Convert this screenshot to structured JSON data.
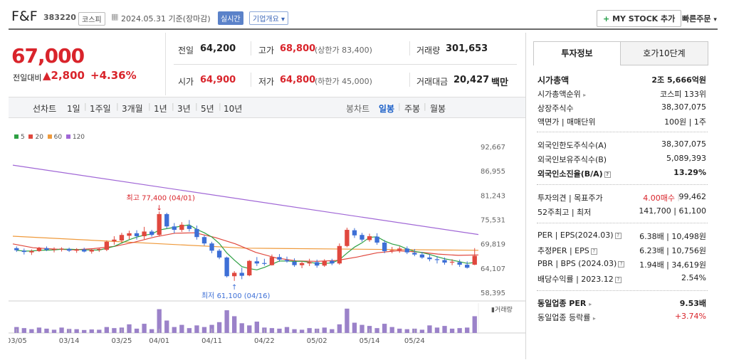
{
  "header": {
    "name": "F&F",
    "code": "383220",
    "market": "코스피",
    "date": "2024.05.31 기준(장마감)",
    "realtime": "실시간",
    "overview": "기업개요",
    "overview_arrow": "▾",
    "mystock_plus": "+",
    "mystock": "MY STOCK 추가",
    "quick_order": "빠른주문",
    "quick_order_arrow": "▾"
  },
  "quote": {
    "price": "67,000",
    "change_label": "전일대비",
    "change_value": "▲2,800",
    "change_pct": "+4.36%",
    "prev_label": "전일",
    "prev": "64,200",
    "high_label": "고가",
    "high": "68,800",
    "upper_limit": "(상한가 83,400)",
    "volume_label": "거래량",
    "volume": "301,653",
    "open_label": "시가",
    "open": "64,900",
    "low_label": "저가",
    "low": "64,800",
    "lower_limit": "(하한가 45,000)",
    "amount_label": "거래대금",
    "amount": "20,427",
    "amount_unit": "백만"
  },
  "period_tabs": [
    "선차트",
    "1일",
    "1주일",
    "3개월",
    "1년",
    "3년",
    "5년",
    "10년"
  ],
  "interval_tabs": [
    "봉차트",
    "일봉",
    "주봉",
    "월봉"
  ],
  "right_tabs": [
    "투자정보",
    "호가10단계"
  ],
  "info": {
    "cap_label": "시가총액",
    "cap": "2조 5,666억원",
    "rank_label": "시가총액순위",
    "rank_arrow": "▸",
    "rank": "코스피 133위",
    "shares_label": "상장주식수",
    "shares": "38,307,075",
    "par_label": "액면가 | 매매단위",
    "par": "100원 | 1주",
    "flimit_label": "외국인한도주식수(A)",
    "flimit": "38,307,075",
    "fhold_label": "외국인보유주식수(B)",
    "fhold": "5,089,393",
    "fratio_label": "외국인소진율(B/A)",
    "fratio": "13.29%",
    "opinion_label": "투자의견 | 목표주가",
    "opinion": "4.00매수",
    "target": "99,462",
    "w52_label": "52주최고 | 최저",
    "w52": "141,700 | 61,100",
    "per_label": "PER | EPS(2024.03)",
    "per": "6.38배 | 10,498원",
    "eper_label": "추정PER | EPS",
    "eper": "6.23배 | 10,756원",
    "pbr_label": "PBR | BPS (2024.03)",
    "pbr": "1.94배 | 34,619원",
    "div_label": "배당수익률 | 2023.12",
    "div": "2.54%",
    "sper_label": "동일업종 PER",
    "sper_arrow": "▸",
    "sper": "9.53배",
    "srate_label": "동일업종 등락률",
    "srate_arrow": "▸",
    "srate": "+3.74%",
    "help": "?"
  },
  "chart_data": {
    "type": "candlestick",
    "legend": [
      {
        "name": "5",
        "color": "#2ea043"
      },
      {
        "name": "20",
        "color": "#e0483e"
      },
      {
        "name": "60",
        "color": "#ef9a3c"
      },
      {
        "name": "120",
        "color": "#a067d6"
      }
    ],
    "y_ticks": [
      "92,667",
      "86,955",
      "81,243",
      "75,531",
      "69,819",
      "64,107",
      "58,395"
    ],
    "ylim": [
      58395,
      92667
    ],
    "x_labels": [
      "03/05",
      "03/14",
      "03/25",
      "04/01",
      "04/11",
      "04/22",
      "05/02",
      "05/14",
      "05/24"
    ],
    "volume_label": "거래량",
    "max_annotation": "최고 77,400 (04/01)",
    "min_annotation": "최저 61,100 (04/16)",
    "up_color": "#e0483e",
    "down_color": "#3d6fd6",
    "ohlc": [
      [
        68800,
        69200,
        67900,
        68300
      ],
      [
        68200,
        68700,
        67300,
        67900
      ],
      [
        67800,
        68500,
        67200,
        68100
      ],
      [
        68100,
        69100,
        67900,
        68900
      ],
      [
        68800,
        69200,
        68100,
        68400
      ],
      [
        68400,
        69000,
        67800,
        68600
      ],
      [
        68500,
        69000,
        68000,
        68700
      ],
      [
        68600,
        68900,
        67900,
        68200
      ],
      [
        68200,
        68800,
        67700,
        68500
      ],
      [
        68500,
        68900,
        67800,
        68000
      ],
      [
        68000,
        68600,
        67500,
        68400
      ],
      [
        68400,
        68900,
        67900,
        68600
      ],
      [
        68400,
        70600,
        68100,
        70300
      ],
      [
        70400,
        71600,
        69600,
        70800
      ],
      [
        70600,
        72400,
        70100,
        71900
      ],
      [
        71700,
        72900,
        70900,
        72300
      ],
      [
        72300,
        73000,
        70800,
        71600
      ],
      [
        71600,
        73800,
        70900,
        72700
      ],
      [
        72700,
        73100,
        71500,
        71900
      ],
      [
        71900,
        77400,
        71600,
        76800
      ],
      [
        76800,
        77100,
        73400,
        73900
      ],
      [
        73900,
        74700,
        72300,
        73100
      ],
      [
        73100,
        74900,
        72600,
        74300
      ],
      [
        74100,
        75400,
        72700,
        73300
      ],
      [
        73300,
        74100,
        70800,
        71400
      ],
      [
        71400,
        71800,
        69400,
        69900
      ],
      [
        69900,
        70300,
        67600,
        68200
      ],
      [
        68200,
        68600,
        66200,
        66600
      ],
      [
        66600,
        66800,
        61900,
        62200
      ],
      [
        62200,
        63400,
        61100,
        63000
      ],
      [
        63000,
        64200,
        61500,
        62300
      ],
      [
        62400,
        66000,
        62200,
        65800
      ],
      [
        65700,
        66700,
        64600,
        65200
      ],
      [
        65300,
        66300,
        64700,
        65100
      ],
      [
        64800,
        67300,
        64700,
        66700
      ],
      [
        66700,
        67400,
        65600,
        66100
      ],
      [
        66000,
        66800,
        65400,
        65700
      ],
      [
        65600,
        66400,
        64400,
        64800
      ],
      [
        64800,
        65700,
        64100,
        65300
      ],
      [
        65200,
        66300,
        64600,
        65500
      ],
      [
        65500,
        66100,
        64200,
        64700
      ],
      [
        64700,
        66200,
        64400,
        65800
      ],
      [
        65800,
        66300,
        64800,
        65200
      ],
      [
        65200,
        69900,
        64900,
        69300
      ],
      [
        69300,
        73600,
        69000,
        73100
      ],
      [
        73000,
        73500,
        71200,
        71800
      ],
      [
        71900,
        72400,
        70300,
        70800
      ],
      [
        70700,
        72200,
        70300,
        71600
      ],
      [
        71500,
        72300,
        69600,
        70100
      ],
      [
        70100,
        70700,
        67600,
        68100
      ],
      [
        68100,
        69100,
        67600,
        68300
      ],
      [
        68300,
        69200,
        67700,
        68700
      ],
      [
        68700,
        69200,
        67400,
        67800
      ],
      [
        67700,
        68600,
        66900,
        67300
      ],
      [
        67300,
        67900,
        66300,
        66600
      ],
      [
        66600,
        67400,
        65700,
        66200
      ],
      [
        66200,
        66900,
        65200,
        66000
      ],
      [
        66000,
        66600,
        64900,
        65400
      ],
      [
        65400,
        66200,
        64800,
        65600
      ],
      [
        65500,
        66100,
        64400,
        64900
      ],
      [
        64900,
        65700,
        64000,
        64200
      ],
      [
        64900,
        68800,
        64800,
        67000
      ]
    ],
    "volume": [
      0.22,
      0.18,
      0.14,
      0.2,
      0.16,
      0.12,
      0.2,
      0.15,
      0.14,
      0.11,
      0.13,
      0.12,
      0.22,
      0.18,
      0.2,
      0.32,
      0.16,
      0.34,
      0.14,
      0.88,
      0.46,
      0.22,
      0.3,
      0.18,
      0.28,
      0.22,
      0.3,
      0.4,
      0.84,
      0.62,
      0.36,
      0.28,
      0.42,
      0.2,
      0.18,
      0.16,
      0.22,
      0.14,
      0.12,
      0.18,
      0.16,
      0.2,
      0.14,
      0.32,
      0.9,
      0.38,
      0.3,
      0.26,
      0.18,
      0.34,
      0.22,
      0.16,
      0.14,
      0.16,
      0.12,
      0.28,
      0.2,
      0.26,
      0.16,
      0.18,
      0.2,
      0.62
    ],
    "ma120": [
      88300,
      72000
    ],
    "ma60": [
      71600,
      68800,
      68300
    ],
    "ma20": [
      69800,
      68900,
      68600,
      68400,
      68700,
      69200,
      70200,
      71400,
      72300,
      72400,
      71300,
      69800,
      67800,
      66500,
      65800,
      65700,
      65900,
      66700,
      67700,
      68200,
      67900,
      67400,
      67100,
      67200
    ]
  }
}
